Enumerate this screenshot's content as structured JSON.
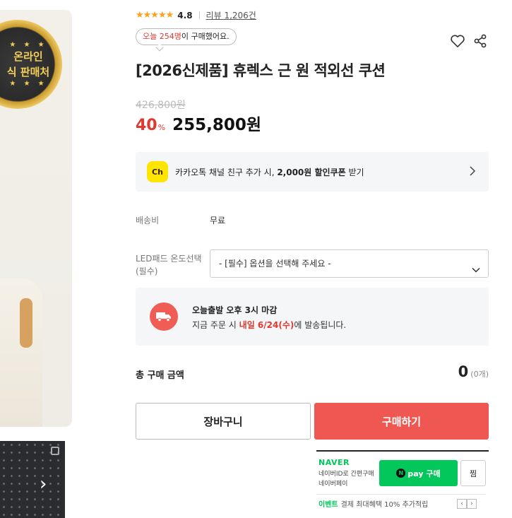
{
  "badge": {
    "line1": "온라인",
    "line2": "식 판매처"
  },
  "rating": {
    "stars": "★★★★★",
    "score": "4.8",
    "review_link": "리뷰 1,206건"
  },
  "purchase_bubble": {
    "prefix": "오늘 254명",
    "suffix": "이 구매했어요."
  },
  "product": {
    "title": "[2026신제품] 휴렉스 근 원 적외선 쿠션"
  },
  "price": {
    "original": "426,800원",
    "discount": "40",
    "discount_unit": "%",
    "sale": "255,800원"
  },
  "coupon": {
    "icon_text": "Ch",
    "text_before": "카카오톡 채널 친구 추가 시, ",
    "text_bold": "2,000원 할인쿠폰",
    "text_after": " 받기"
  },
  "shipping_fee": {
    "label": "배송비",
    "value": "무료"
  },
  "option": {
    "label_line1": "LED패드 온도선택",
    "label_line2": "(필수)",
    "placeholder": "- [필수] 옵션을 선택해 주세요 -"
  },
  "dispatch": {
    "line1": "오늘출발 오후 3시 마감",
    "line2_before": "지금 주문 시 ",
    "line2_highlight": "내일 6/24(수)",
    "line2_after": "에 발송됩니다."
  },
  "total": {
    "label": "총 구매 금액",
    "amount": "0",
    "count": "(0개)"
  },
  "buttons": {
    "cart": "장바구니",
    "buy": "구매하기"
  },
  "naver": {
    "logo": "NAVER",
    "sub1": "네이버ID로 간편구매",
    "sub2": "네이버페이",
    "npay_circle": "N",
    "npay_label": "pay 구매",
    "wish": "찜",
    "event_label": "이벤트",
    "event_text": "결제 최대혜택 10% 추가적립",
    "prev": "‹",
    "next": "›"
  },
  "thumbnail": {
    "arrow": "›"
  },
  "colors": {
    "accent_red": "#e0392f",
    "buy_button": "#ef5753",
    "naver_green": "#03c75a",
    "kakao_yellow": "#fee500",
    "star_orange": "#ff9f1a"
  },
  "icons": [
    "heart-icon",
    "share-icon",
    "chevron-right-icon",
    "chevron-down-icon",
    "truck-icon",
    "copy-icon"
  ]
}
